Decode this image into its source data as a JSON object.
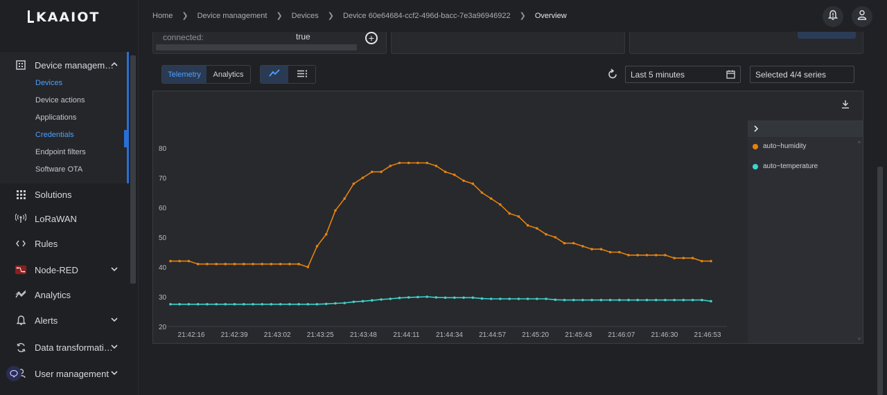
{
  "brand": {
    "logo_text": "kaaiot"
  },
  "breadcrumb": [
    {
      "label": "Home"
    },
    {
      "label": "Device management"
    },
    {
      "label": "Devices"
    },
    {
      "label": "Device 60e64684-ccf2-496d-bacc-7e3a96946922"
    },
    {
      "label": "Overview"
    }
  ],
  "sidebar": {
    "device_management": {
      "label": "Device managem…",
      "children": [
        {
          "label": "Devices",
          "active": true
        },
        {
          "label": "Device actions",
          "active": false
        },
        {
          "label": "Applications",
          "active": false
        },
        {
          "label": "Credentials",
          "active": true
        },
        {
          "label": "Endpoint filters",
          "active": false
        },
        {
          "label": "Software OTA",
          "active": false
        }
      ]
    },
    "items": [
      {
        "label": "Solutions",
        "icon": "grid-icon"
      },
      {
        "label": "LoRaWAN",
        "icon": "antenna-icon"
      },
      {
        "label": "Rules",
        "icon": "code-brackets-icon"
      },
      {
        "label": "Node-RED",
        "icon": "node-red-icon"
      },
      {
        "label": "Analytics",
        "icon": "analytics-icon"
      },
      {
        "label": "Alerts",
        "icon": "bell-icon"
      },
      {
        "label": "Data transformati…",
        "icon": "transform-icon"
      },
      {
        "label": "User management",
        "icon": "user-icon"
      }
    ]
  },
  "top_card": {
    "key": "connected:",
    "value": "true"
  },
  "toolbar": {
    "tabs": [
      {
        "label": "Telemetry",
        "active": true
      },
      {
        "label": "Analytics",
        "active": false
      }
    ],
    "time_range": "Last 5 minutes",
    "series_select": "Selected 4/4 series"
  },
  "chart_data": {
    "type": "line",
    "x": [
      "21:42:16",
      "",
      "",
      "",
      "",
      "",
      "",
      "",
      "",
      "",
      "",
      "",
      "",
      "",
      "",
      "",
      "",
      "",
      "",
      "",
      "",
      "",
      "",
      "",
      "",
      "",
      "",
      "",
      "",
      "",
      "",
      "",
      "",
      "",
      "",
      "",
      "",
      "",
      "",
      "",
      "",
      "",
      "",
      "",
      "",
      "",
      "",
      "",
      "",
      "",
      "",
      "",
      "",
      "",
      "",
      "",
      "",
      "",
      "",
      "",
      "",
      "",
      "",
      "",
      "",
      ""
    ],
    "x_ticks": [
      "21:42:16",
      "21:42:39",
      "21:43:02",
      "21:43:25",
      "21:43:48",
      "21:44:11",
      "21:44:34",
      "21:44:57",
      "21:45:20",
      "21:45:43",
      "21:46:07",
      "21:46:30",
      "21:46:53"
    ],
    "y_ticks": [
      20,
      30,
      40,
      50,
      60,
      70,
      80
    ],
    "ylim": [
      20,
      80
    ],
    "series": [
      {
        "name": "auto~humidity",
        "color": "#e8820e",
        "values": [
          42,
          42,
          42,
          41,
          41,
          41,
          41,
          41,
          41,
          41,
          41,
          41,
          41,
          41,
          41,
          40,
          47,
          51,
          59,
          63,
          68,
          70,
          72,
          72,
          74,
          75,
          75,
          75,
          75,
          74,
          72,
          71,
          69,
          68,
          65,
          63,
          61,
          58,
          57,
          54,
          53,
          51,
          50,
          48,
          48,
          47,
          46,
          46,
          45,
          45,
          44,
          44,
          44,
          44,
          44,
          43,
          43,
          43,
          42,
          42
        ]
      },
      {
        "name": "auto~temperature",
        "color": "#3fd3cc",
        "values": [
          27.5,
          27.5,
          27.5,
          27.5,
          27.5,
          27.5,
          27.5,
          27.5,
          27.5,
          27.5,
          27.5,
          27.5,
          27.5,
          27.5,
          27.5,
          27.5,
          27.5,
          27.6,
          27.8,
          27.9,
          28.3,
          28.5,
          28.8,
          29.1,
          29.3,
          29.6,
          29.8,
          29.9,
          30.0,
          29.8,
          29.7,
          29.7,
          29.7,
          29.7,
          29.4,
          29.3,
          29.3,
          29.3,
          29.3,
          29.3,
          29.3,
          29.3,
          29.0,
          28.9,
          28.9,
          28.9,
          28.9,
          28.9,
          28.9,
          28.9,
          28.9,
          28.9,
          28.9,
          28.9,
          28.9,
          28.9,
          28.9,
          28.9,
          28.9,
          28.5
        ]
      }
    ],
    "legend_position": "right",
    "grid": false
  }
}
